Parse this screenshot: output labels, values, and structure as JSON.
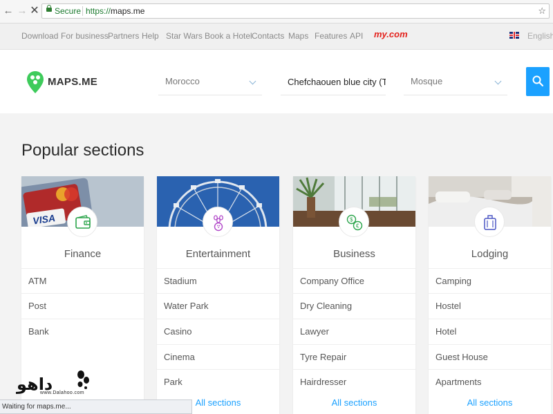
{
  "browser": {
    "secure_label": "Secure",
    "url_scheme": "https://",
    "url_host": "maps.me"
  },
  "topnav": {
    "items": [
      "Download",
      "For business",
      "Partners",
      "Help",
      "Star Wars",
      "Book a Hotel",
      "Contacts",
      "Maps",
      "Features",
      "API"
    ],
    "partner_logo": "my.com",
    "language": "English"
  },
  "header": {
    "logo_text": "MAPS.ME",
    "country": "Morocco",
    "search_value": "Chefchaouen blue city (Tang",
    "category": "Mosque"
  },
  "main": {
    "heading": "Popular sections",
    "all_sections_label": "All sections",
    "cards": [
      {
        "title": "Finance",
        "icon": "wallet-icon",
        "items": [
          "ATM",
          "Post",
          "Bank"
        ]
      },
      {
        "title": "Entertainment",
        "icon": "bowling-icon",
        "items": [
          "Stadium",
          "Water Park",
          "Casino",
          "Cinema",
          "Park"
        ]
      },
      {
        "title": "Business",
        "icon": "currency-exchange-icon",
        "items": [
          "Company Office",
          "Dry Cleaning",
          "Lawyer",
          "Tyre Repair",
          "Hairdresser"
        ]
      },
      {
        "title": "Lodging",
        "icon": "suitcase-icon",
        "items": [
          "Camping",
          "Hostel",
          "Hotel",
          "Guest House",
          "Apartments"
        ]
      }
    ]
  },
  "status": {
    "text": "Waiting for maps.me..."
  },
  "watermark": {
    "text": "داهو",
    "url": "www.Dalahoo.com"
  },
  "colors": {
    "accent": "#1ba1ff",
    "logo_green": "#3ecb5b",
    "partner_red": "#e3211c"
  }
}
